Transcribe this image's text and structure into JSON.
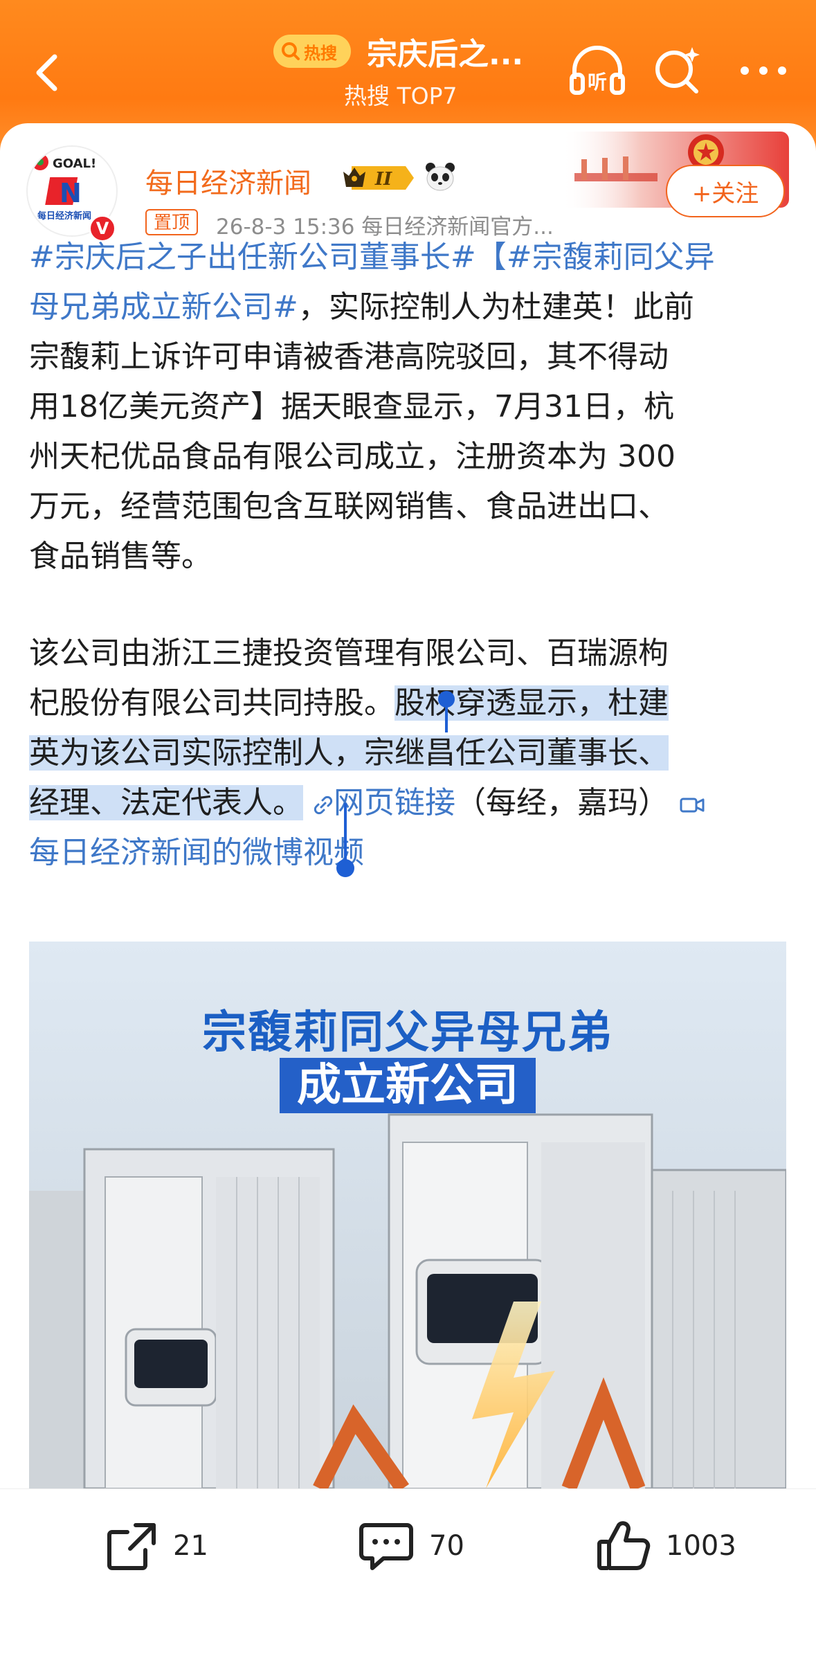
{
  "header": {
    "hot_badge": "热搜",
    "title": "宗庆后之...",
    "subtitle": "热搜 TOP7",
    "colors": {
      "gradient_top": "#ff8a1e",
      "gradient_bottom": "#ff9a3a"
    }
  },
  "post": {
    "author": "每日经济新闻",
    "level_badge": "II",
    "pin_label": "置顶",
    "meta": "26-8-3 15:36  每日经济新闻官方...",
    "follow_label": "+关注",
    "avatar_text": {
      "top": "GOAL!",
      "letter": "N",
      "name": "每日经济新闻"
    },
    "verified_label": "V",
    "text": {
      "l1_link": "#宗庆后之子出任新公司董事长#【#宗馥莉同父异",
      "l2_link": "母兄弟成立新公司#",
      "l2_rest": "，实际控制人为杜建英！此前",
      "l3": "宗馥莉上诉许可申请被香港高院驳回，其不得动",
      "l4": "用18亿美元资产】据天眼查显示，7月31日，杭",
      "l5": "州天杞优品食品有限公司成立，注册资本为 300",
      "l6": "万元，经营范围包含互联网销售、食品进出口、",
      "l7": "食品销售等。",
      "l8": "该公司由浙江三捷投资管理有限公司、百瑞源枸",
      "l9_plain": "杞股份有限公司共同持股。",
      "l9_sel": "股权穿透显示，杜建",
      "l10_sel": "英为该公司实际控制人，宗继昌任公司董事长、",
      "l11_sel": "经理、法定代表人。",
      "l11_link": "网页链接",
      "l11_rest": "（每经，嘉玛）",
      "l12_link": "每日经济新闻的微博视频"
    },
    "image": {
      "title_line1": "宗馥莉同父异母兄弟",
      "title_line2": "成立新公司"
    }
  },
  "actions": {
    "share_count": "21",
    "comment_count": "70",
    "like_count": "1003"
  },
  "colors": {
    "accent_orange": "#f26b1d",
    "link_blue": "#3f78c8",
    "selection": "#cfe0f6"
  }
}
